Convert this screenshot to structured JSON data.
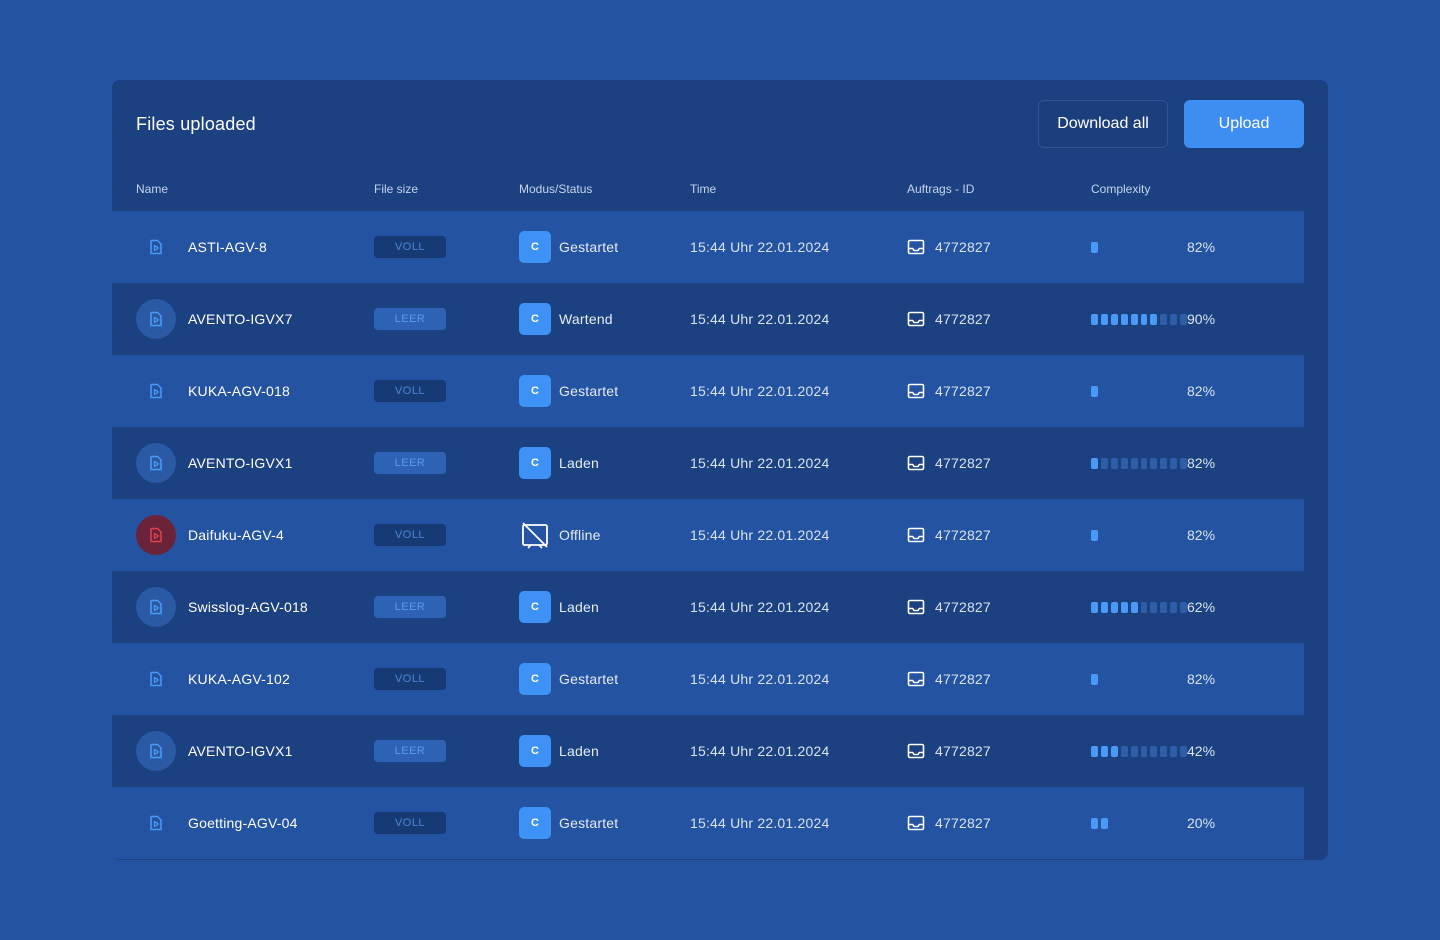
{
  "header": {
    "title": "Files uploaded",
    "download_all_label": "Download all",
    "upload_label": "Upload"
  },
  "columns": {
    "name": "Name",
    "file_size": "File size",
    "status": "Modus/Status",
    "time": "Time",
    "auftrags_id": "Auftrags - ID",
    "complexity": "Complexity"
  },
  "colors": {
    "background": "#2353a1",
    "panel": "#1b4180",
    "accent": "#3e8ef2",
    "error": "#e0434f"
  },
  "rows": [
    {
      "icon": "file-icon",
      "icon_style": "plain",
      "name": "ASTI-AGV-8",
      "size": "VOLL",
      "status_icon": "C",
      "status": "Gestartet",
      "time": "15:44 Uhr 22.01.2024",
      "id": "4772827",
      "complexity_segments": [
        1,
        0,
        0,
        0,
        0,
        0,
        0,
        0,
        0,
        0
      ],
      "complexity_track": false,
      "complexity": "82%"
    },
    {
      "icon": "file-icon",
      "icon_style": "circled",
      "name": "AVENTO-IGVX7",
      "size": "LEER",
      "status_icon": "C",
      "status": "Wartend",
      "time": "15:44 Uhr 22.01.2024",
      "id": "4772827",
      "complexity_segments": [
        1,
        1,
        1,
        1,
        1,
        1,
        1,
        0,
        0,
        0
      ],
      "complexity_track": true,
      "complexity": "90%"
    },
    {
      "icon": "file-icon",
      "icon_style": "plain",
      "name": "KUKA-AGV-018",
      "size": "VOLL",
      "status_icon": "C",
      "status": "Gestartet",
      "time": "15:44 Uhr 22.01.2024",
      "id": "4772827",
      "complexity_segments": [
        1,
        0,
        0,
        0,
        0,
        0,
        0,
        0,
        0,
        0
      ],
      "complexity_track": false,
      "complexity": "82%"
    },
    {
      "icon": "file-icon",
      "icon_style": "circled",
      "name": "AVENTO-IGVX1",
      "size": "LEER",
      "status_icon": "C",
      "status": "Laden",
      "time": "15:44 Uhr 22.01.2024",
      "id": "4772827",
      "complexity_segments": [
        1,
        0,
        0,
        0,
        0,
        0,
        0,
        0,
        0,
        0
      ],
      "complexity_track": true,
      "complexity": "82%"
    },
    {
      "icon": "file-icon",
      "icon_style": "error",
      "name": "Daifuku-AGV-4",
      "size": "VOLL",
      "status_icon": "offline",
      "status": "Offline",
      "time": "15:44 Uhr 22.01.2024",
      "id": "4772827",
      "complexity_segments": [
        1,
        0,
        0,
        0,
        0,
        0,
        0,
        0,
        0,
        0
      ],
      "complexity_track": false,
      "complexity": "82%"
    },
    {
      "icon": "file-icon",
      "icon_style": "circled",
      "name": "Swisslog-AGV-018",
      "size": "LEER",
      "status_icon": "C",
      "status": "Laden",
      "time": "15:44 Uhr 22.01.2024",
      "id": "4772827",
      "complexity_segments": [
        1,
        1,
        1,
        1,
        1,
        0,
        0,
        0,
        0,
        0
      ],
      "complexity_track": true,
      "complexity": "62%"
    },
    {
      "icon": "file-icon",
      "icon_style": "plain",
      "name": "KUKA-AGV-102",
      "size": "VOLL",
      "status_icon": "C",
      "status": "Gestartet",
      "time": "15:44 Uhr 22.01.2024",
      "id": "4772827",
      "complexity_segments": [
        1,
        0,
        0,
        0,
        0,
        0,
        0,
        0,
        0,
        0
      ],
      "complexity_track": false,
      "complexity": "82%"
    },
    {
      "icon": "file-icon",
      "icon_style": "circled",
      "name": "AVENTO-IGVX1",
      "size": "LEER",
      "status_icon": "C",
      "status": "Laden",
      "time": "15:44 Uhr 22.01.2024",
      "id": "4772827",
      "complexity_segments": [
        1,
        1,
        1,
        0,
        0,
        0,
        0,
        0,
        0,
        0
      ],
      "complexity_track": true,
      "complexity": "42%"
    },
    {
      "icon": "file-icon",
      "icon_style": "plain",
      "name": "Goetting-AGV-04",
      "size": "VOLL",
      "status_icon": "C",
      "status": "Gestartet",
      "time": "15:44 Uhr 22.01.2024",
      "id": "4772827",
      "complexity_segments": [
        1,
        1,
        0,
        0,
        0,
        0,
        0,
        0,
        0,
        0
      ],
      "complexity_track": false,
      "complexity": "20%"
    }
  ]
}
